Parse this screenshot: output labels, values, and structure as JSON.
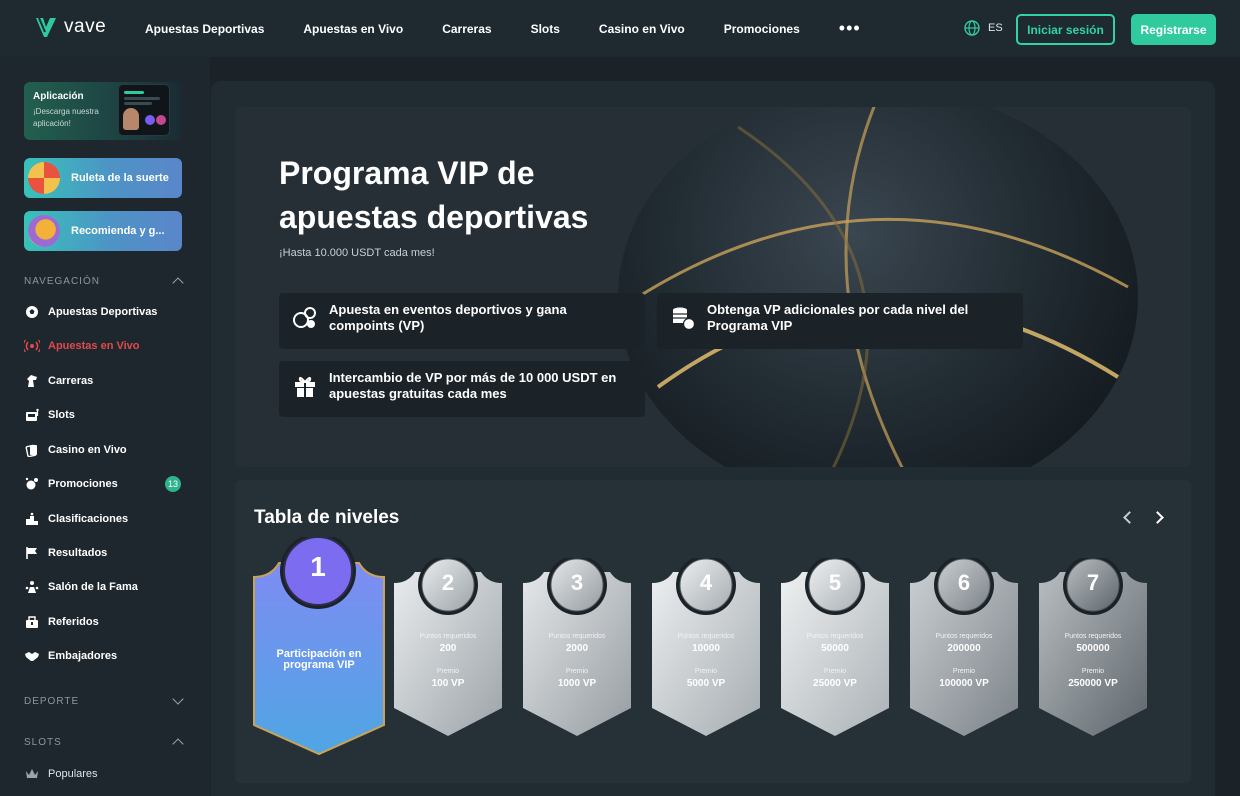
{
  "header": {
    "logo_text": "vave",
    "nav": [
      "Apuestas Deportivas",
      "Apuestas en Vivo",
      "Carreras",
      "Slots",
      "Casino en Vivo",
      "Promociones"
    ],
    "more": "•••",
    "lang": "ES",
    "login": "Iniciar sesión",
    "register": "Registrarse"
  },
  "sidebar": {
    "app_title": "Aplicación",
    "app_sub": "¡Descarga nuestra aplicación!",
    "promo1": "Ruleta de la suerte",
    "promo2": "Recomienda y g...",
    "nav_heading": "NAVEGACIÓN",
    "items": [
      {
        "label": "Apuestas Deportivas",
        "icon": "soccer-ball-icon"
      },
      {
        "label": "Apuestas en Vivo",
        "icon": "live-signal-icon"
      },
      {
        "label": "Carreras",
        "icon": "horse-icon"
      },
      {
        "label": "Slots",
        "icon": "slot-machine-icon"
      },
      {
        "label": "Casino en Vivo",
        "icon": "cards-icon"
      },
      {
        "label": "Promociones",
        "icon": "promo-icon"
      },
      {
        "label": "Clasificaciones",
        "icon": "podium-icon"
      },
      {
        "label": "Resultados",
        "icon": "flag-icon"
      },
      {
        "label": "Salón de la Fama",
        "icon": "trophy-person-icon"
      },
      {
        "label": "Referidos",
        "icon": "referral-icon"
      },
      {
        "label": "Embajadores",
        "icon": "handshake-icon"
      }
    ],
    "promo_badge": "13",
    "sport_heading": "DEPORTE",
    "slots_heading": "SLOTS",
    "popular": "Populares"
  },
  "hero": {
    "title": "Programa VIP de apuestas deportivas",
    "subtitle": "¡Hasta 10.000 USDT cada mes!",
    "features": [
      "Apuesta en eventos deportivos y gana compoints (VP)",
      "Obtenga VP adicionales por cada nivel del Programa VIP",
      "Intercambio de VP por más de 10 000 USDT en apuestas gratuitas cada mes"
    ]
  },
  "levels": {
    "title": "Tabla de niveles",
    "first": {
      "num": "1",
      "label": "Participación en programa VIP"
    },
    "req_label": "Puntos requeridos",
    "prize_label": "Premio",
    "tiers": [
      {
        "num": "2",
        "points": "200",
        "prize": "100 VP"
      },
      {
        "num": "3",
        "points": "2000",
        "prize": "1000 VP"
      },
      {
        "num": "4",
        "points": "10000",
        "prize": "5000 VP"
      },
      {
        "num": "5",
        "points": "50000",
        "prize": "25000 VP"
      },
      {
        "num": "6",
        "points": "200000",
        "prize": "100000 VP"
      },
      {
        "num": "7",
        "points": "500000",
        "prize": "250000 VP"
      }
    ]
  },
  "colors": {
    "accent": "#2fcb9e",
    "live": "#e04a4a",
    "bg": "#1b2329"
  }
}
